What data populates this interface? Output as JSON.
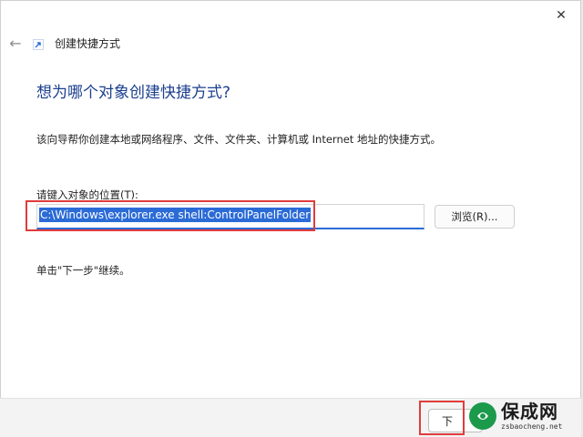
{
  "window": {
    "title": "创建快捷方式",
    "close_glyph": "✕",
    "back_glyph": "←"
  },
  "main": {
    "heading": "想为哪个对象创建快捷方式?",
    "description": "该向导帮你创建本地或网络程序、文件、文件夹、计算机或 Internet 地址的快捷方式。",
    "location_label": "请键入对象的位置(T):",
    "location_value": "C:\\Windows\\explorer.exe shell:ControlPanelFolder",
    "browse_label": "浏览(R)...",
    "hint": "单击\"下一步\"继续。"
  },
  "footer": {
    "next_label": "下"
  },
  "watermark": {
    "text": "保成网",
    "url": "zsbaocheng.net"
  },
  "colors": {
    "heading": "#1b3f8f",
    "accent": "#2b6bd6",
    "annotation_red": "#e03c3c",
    "watermark_green": "#1b9a4b"
  },
  "icons": [
    "close-icon",
    "back-arrow-icon",
    "shortcut-icon",
    "watermark-logo-icon"
  ]
}
